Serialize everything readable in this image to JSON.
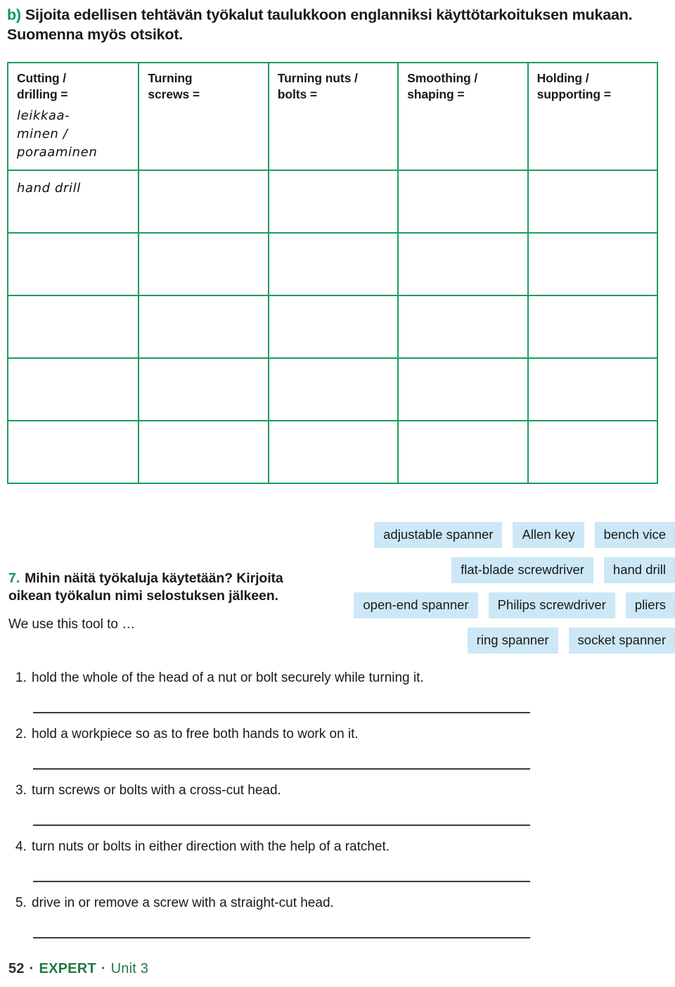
{
  "task": {
    "letter": "b)",
    "instruction": "Sijoita edellisen tehtävän työkalut taulukkoon englanniksi käyttötarkoituksen mukaan. Suomenna myös otsikot."
  },
  "table": {
    "columns": [
      {
        "header": "Cutting /\ndrilling =",
        "translation": "leikkaa-\nminen /\nporaaminen"
      },
      {
        "header": "Turning\nscrews =",
        "translation": ""
      },
      {
        "header": "Turning nuts /\nbolts =",
        "translation": ""
      },
      {
        "header": "Smoothing /\nshaping =",
        "translation": ""
      },
      {
        "header": "Holding /\nsupporting =",
        "translation": ""
      }
    ],
    "rows": [
      [
        "hand drill",
        "",
        "",
        "",
        ""
      ],
      [
        "",
        "",
        "",
        "",
        ""
      ],
      [
        "",
        "",
        "",
        "",
        ""
      ],
      [
        "",
        "",
        "",
        "",
        ""
      ],
      [
        "",
        "",
        "",
        "",
        ""
      ]
    ]
  },
  "word_bank": {
    "rows": [
      [
        "adjustable spanner",
        "Allen key",
        "bench vice"
      ],
      [
        "flat-blade screwdriver",
        "hand drill"
      ],
      [
        "open-end spanner",
        "Philips screwdriver",
        "pliers"
      ],
      [
        "ring spanner",
        "socket spanner"
      ]
    ]
  },
  "question7": {
    "number": "7.",
    "heading": "Mihin näitä työkaluja käytetään? Kirjoita oikean työkalun nimi selostuksen jälkeen.",
    "prompt": "We use this tool to …",
    "items": [
      {
        "num": "1.",
        "text": "hold the whole of the head of a nut or bolt securely while turning it."
      },
      {
        "num": "2.",
        "text": "hold a workpiece so as to free both hands to work on it."
      },
      {
        "num": "3.",
        "text": "turn screws or bolts with a cross-cut head."
      },
      {
        "num": "4.",
        "text": "turn nuts or bolts in either direction with the help of a ratchet."
      },
      {
        "num": "5.",
        "text": "drive in or remove a screw with a straight-cut head."
      }
    ]
  },
  "footer": {
    "page_number": "52",
    "separator": "·",
    "brand": "EXPERT",
    "unit": "Unit 3"
  },
  "colors": {
    "accent_green": "#009a52",
    "table_border_green": "#1a9e5c",
    "footer_green": "#1f7a43",
    "chip_blue": "#cce8f6",
    "rule_gray": "#3b3b3b"
  }
}
